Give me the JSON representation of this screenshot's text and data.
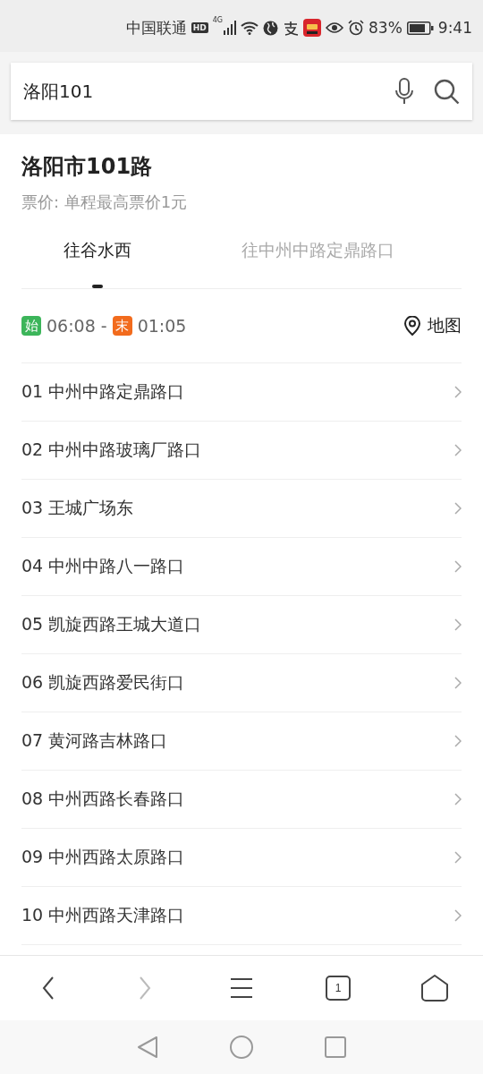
{
  "status_bar": {
    "carrier": "中国联通",
    "hd": "HD",
    "network": "4G",
    "battery": "83%",
    "time": "9:41"
  },
  "search": {
    "value": "洛阳101"
  },
  "route": {
    "title": "洛阳市101路",
    "fare": "票价: 单程最高票价1元"
  },
  "tabs": [
    {
      "label": "往谷水西",
      "selected": true
    },
    {
      "label": "往中州中路定鼎路口",
      "selected": false
    }
  ],
  "schedule": {
    "start_badge": "始",
    "start_time": "06:08 -",
    "end_badge": "末",
    "end_time": "01:05",
    "map_label": "地图"
  },
  "stops": [
    {
      "label": "01 中州中路定鼎路口"
    },
    {
      "label": "02 中州中路玻璃厂路口"
    },
    {
      "label": "03 王城广场东"
    },
    {
      "label": "04 中州中路八一路口"
    },
    {
      "label": "05 凯旋西路王城大道口"
    },
    {
      "label": "06 凯旋西路爱民街口"
    },
    {
      "label": "07 黄河路吉林路口"
    },
    {
      "label": "08 中州西路长春路口"
    },
    {
      "label": "09 中州西路太原路口"
    },
    {
      "label": "10 中州西路天津路口"
    }
  ],
  "browser_bar": {
    "back_disabled": false,
    "forward_disabled": true,
    "tab_count": "1"
  }
}
